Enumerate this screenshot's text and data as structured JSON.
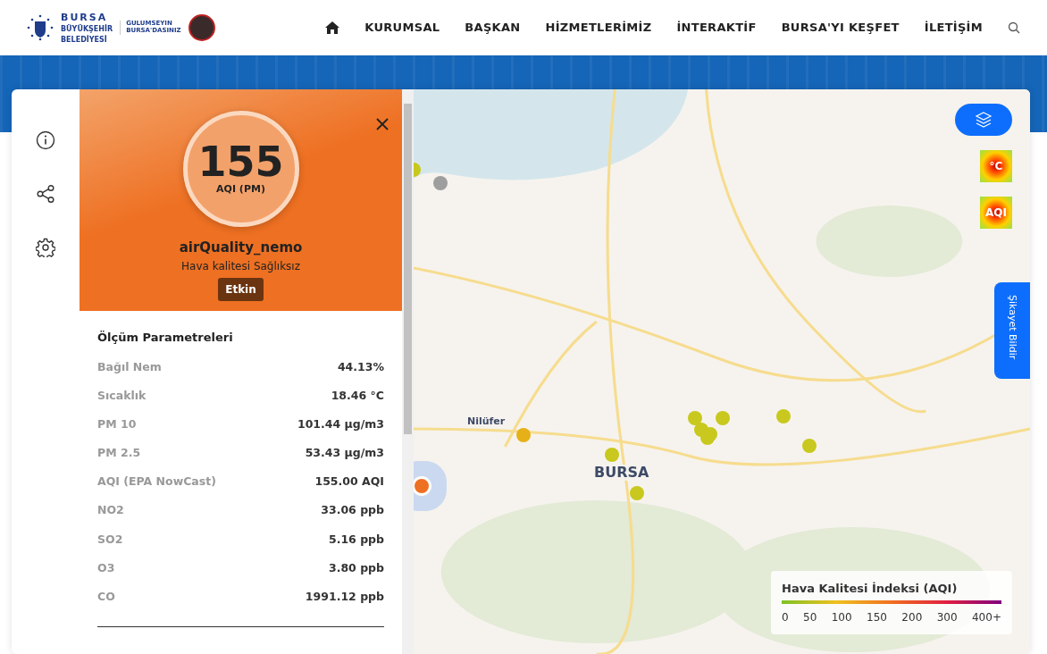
{
  "header": {
    "logo": {
      "line_1": "BURSA",
      "line_2": "BÜYÜKŞEHİR",
      "line_3": "BELEDİYESİ"
    },
    "slogan": {
      "line_1": "GULUMSEYIN",
      "line_2": "BURSA'DASINIZ"
    },
    "nav": [
      {
        "label": "KURUMSAL"
      },
      {
        "label": "BAŞKAN"
      },
      {
        "label": "HİZMETLERİMİZ"
      },
      {
        "label": "İNTERAKTİF"
      },
      {
        "label": "BURSA'YI KEŞFET"
      },
      {
        "label": "İLETİŞİM"
      }
    ]
  },
  "station": {
    "aqi": "155",
    "aqi_label": "AQI (PM)",
    "name": "airQuality_nemo",
    "status": "Hava kalitesi Sağlıksız",
    "badge": "Etkin",
    "color": "#ee7022",
    "section_title": "Ölçüm Parametreleri",
    "parameters": [
      {
        "name": "Bağıl Nem",
        "value": "44.13%"
      },
      {
        "name": "Sıcaklık",
        "value": "18.46 °C"
      },
      {
        "name": "PM 10",
        "value": "101.44 µg/m3"
      },
      {
        "name": "PM 2.5",
        "value": "53.43 µg/m3"
      },
      {
        "name": "AQI (EPA NowCast)",
        "value": "155.00 AQI"
      },
      {
        "name": "NO2",
        "value": "33.06 ppb"
      },
      {
        "name": "SO2",
        "value": "5.16 ppb"
      },
      {
        "name": "O3",
        "value": "3.80 ppb"
      },
      {
        "name": "CO",
        "value": "1991.12 ppb"
      }
    ]
  },
  "map": {
    "labels": [
      {
        "text": "Nilüfer"
      },
      {
        "text": "BURSA"
      }
    ],
    "markers": [
      {
        "color": "#9e9e9e",
        "selected": false
      },
      {
        "color": "#c8c81e",
        "selected": false
      },
      {
        "color": "#e6b019",
        "selected": false
      },
      {
        "color": "#c8c81e",
        "selected": false
      },
      {
        "color": "#c8c81e",
        "selected": false
      },
      {
        "color": "#c8c81e",
        "selected": false
      },
      {
        "color": "#c8c81e",
        "selected": false
      },
      {
        "color": "#c8c81e",
        "selected": false
      },
      {
        "color": "#c8c81e",
        "selected": false
      },
      {
        "color": "#c8c81e",
        "selected": false
      },
      {
        "color": "#c8c81e",
        "selected": false
      },
      {
        "color": "#c8c81e",
        "selected": false
      },
      {
        "color": "#ee7022",
        "selected": true
      }
    ],
    "layers": [
      {
        "label": "°C"
      },
      {
        "label": "AQI"
      }
    ],
    "complaint_tab": "Şikayet Bildir",
    "legend": {
      "title": "Hava Kalitesi İndeksi (AQI)",
      "ticks": [
        "0",
        "50",
        "100",
        "150",
        "200",
        "300",
        "400+"
      ]
    }
  }
}
